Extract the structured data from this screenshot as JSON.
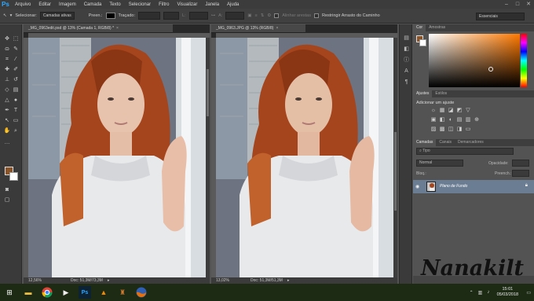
{
  "menubar": {
    "logo": "Ps",
    "items": [
      "Arquivo",
      "Editar",
      "Imagem",
      "Camada",
      "Texto",
      "Selecionar",
      "Filtro",
      "Visualizar",
      "Janela",
      "Ajuda"
    ],
    "controls": {
      "minimize": "–",
      "maximize": "□",
      "close": "✕"
    }
  },
  "options": {
    "select_label": "Selecionar:",
    "select_value": "Camadas ativas",
    "fill_label": "Preen.:",
    "stroke_label": "Traçado:",
    "align_edges": "Alinhar arestas",
    "constrain_path": "Restringir Arrasto do Caminho",
    "workspace": "Essenciais"
  },
  "documents": [
    {
      "tab": "_MG_0963edit.psd @ 13% (Camada 1, RGB/8) *",
      "zoom": "12,56%",
      "doc_info": "Doc: 51,3M/73,3M"
    },
    {
      "tab": "_MG_0963.JPG @ 13% (RGB/8)",
      "zoom": "13,02%",
      "doc_info": "Doc: 51,3M/51,3M"
    }
  ],
  "color_panel": {
    "tabs": [
      "Cor",
      "Amostras"
    ],
    "foreground": "#8a5328",
    "background": "#ffffff"
  },
  "adjust_panel": {
    "tabs": [
      "Ajustes",
      "Estilos"
    ],
    "title": "Adicionar um ajuste",
    "row1": [
      "☼",
      "▦",
      "◪",
      "◩",
      "▽"
    ],
    "row2": [
      "▣",
      "◧",
      "◐",
      "▤",
      "▥",
      "⊕"
    ],
    "row3": [
      "▨",
      "▩",
      "◫",
      "◨",
      "▭"
    ]
  },
  "layers_panel": {
    "tabs": [
      "Camadas",
      "Canais",
      "Demarcadores"
    ],
    "filter": "Tipo",
    "blend_mode": "Normal",
    "opacity_label": "Opacidade:",
    "opacity_value": "",
    "lock_label": "Bloq.:",
    "fill_label": "Preench.:",
    "fill_value": "",
    "layer_name": "Plano de Fundo"
  },
  "signature": "Nanakilt",
  "taskbar": {
    "time": "15:01",
    "date": "05/03/2018",
    "apps": [
      "windows-start",
      "file-explorer",
      "chrome",
      "media-player",
      "photoshop",
      "vlc",
      "installer",
      "firefox"
    ]
  }
}
